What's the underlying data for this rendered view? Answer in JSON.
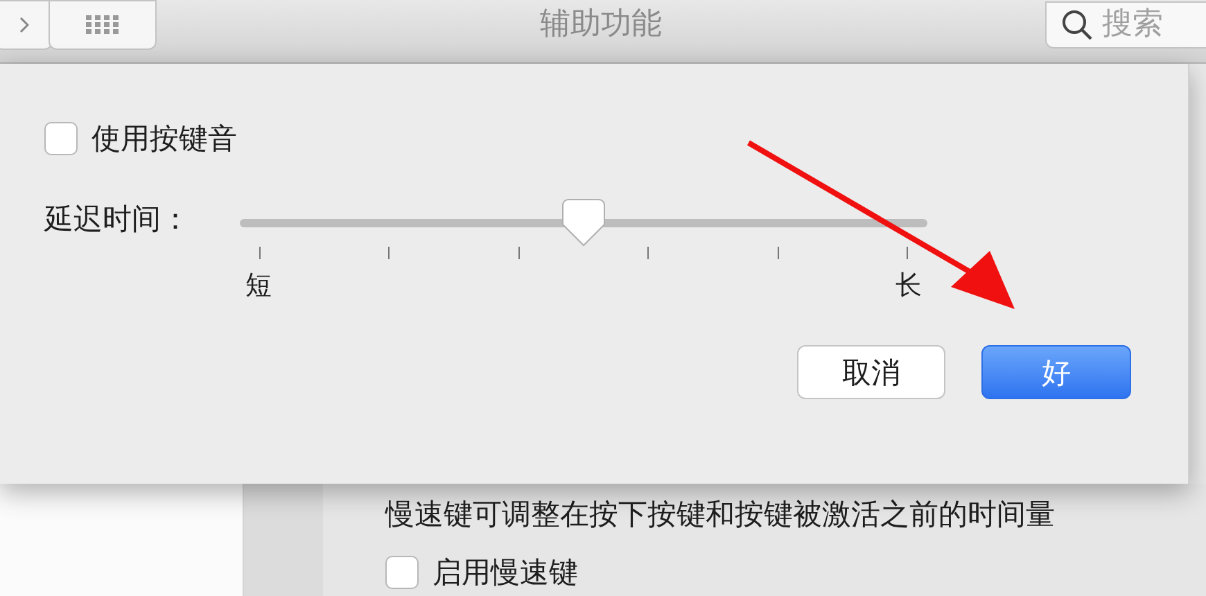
{
  "toolbar": {
    "title": "辅助功能",
    "search": {
      "placeholder": "搜索"
    }
  },
  "sheet": {
    "checkbox": {
      "label": "使用按键音",
      "checked": false
    },
    "slider": {
      "label": "延迟时间：",
      "level": 0.5,
      "min_label": "短",
      "max_label": "长"
    },
    "buttons": [
      {
        "label": "取消",
        "kind": "secondary"
      },
      {
        "label": "好",
        "kind": "primary"
      }
    ]
  },
  "background": {
    "description": "慢速键可调整在按下按键和按键被激活之前的时间量",
    "checkbox": {
      "label": "启用慢速键",
      "checked": false
    }
  }
}
